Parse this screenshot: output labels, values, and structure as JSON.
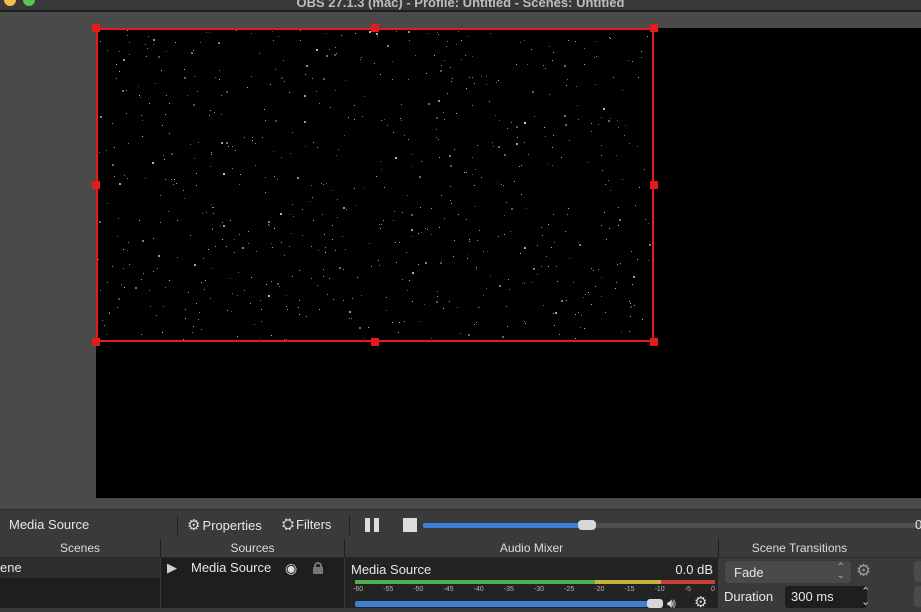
{
  "window": {
    "title": "OBS 27.1.3 (mac) - Profile: Untitled - Scenes: Untitled"
  },
  "colors": {
    "selection_red": "#e31b1b",
    "accent_blue": "#3b80d4",
    "meter_green": "#4caf50",
    "meter_yellow": "#c8b23a",
    "meter_red": "#c8403a"
  },
  "source_toolbar": {
    "source_name": "Media Source",
    "properties_label": "Properties",
    "filters_label": "Filters",
    "pause_icon": "pause-icon",
    "stop_icon": "stop-icon",
    "seek_progress": 0.33,
    "time_text": "0"
  },
  "scenes": {
    "header": "Scenes",
    "items": [
      {
        "label": "ene"
      }
    ]
  },
  "sources": {
    "header": "Sources",
    "items": [
      {
        "label": "Media Source",
        "visible": true,
        "locked": false
      }
    ]
  },
  "audio_mixer": {
    "header": "Audio Mixer",
    "channels": [
      {
        "name": "Media Source",
        "level": "0.0 dB",
        "volume": 0.95
      }
    ],
    "ticks": [
      "-60",
      "-55",
      "-50",
      "-45",
      "-40",
      "-35",
      "-30",
      "-25",
      "-20",
      "-15",
      "-10",
      "-5",
      "0"
    ]
  },
  "scene_transitions": {
    "header": "Scene Transitions",
    "transition": "Fade",
    "duration_label": "Duration",
    "duration_value": "300 ms"
  }
}
